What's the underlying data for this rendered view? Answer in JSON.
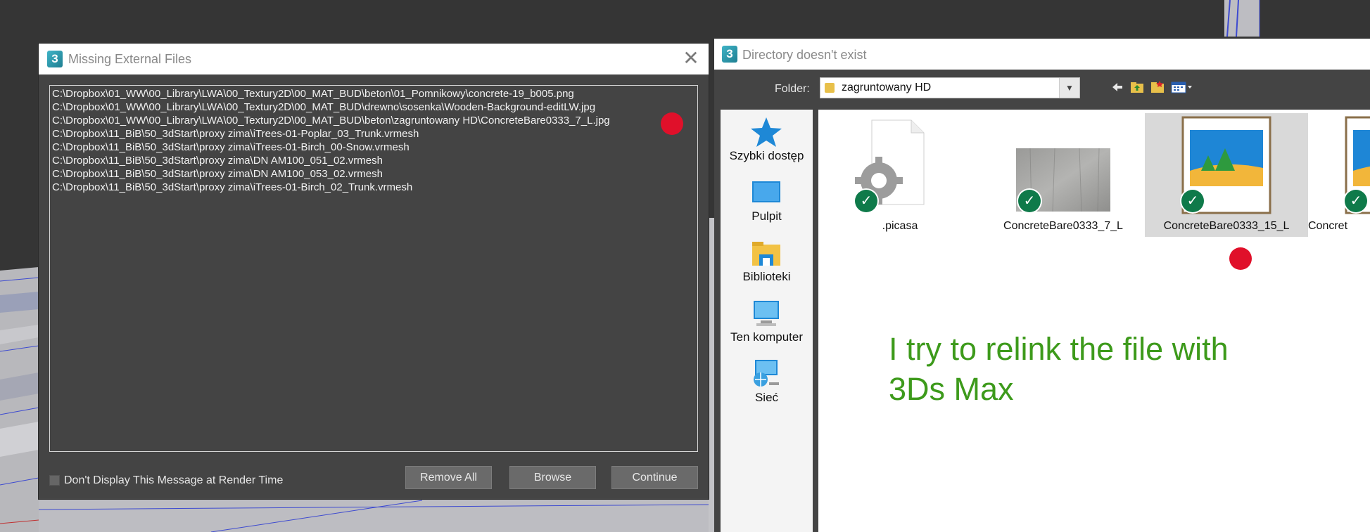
{
  "missing_dialog": {
    "title": "Missing External Files",
    "files": [
      "C:\\Dropbox\\01_WW\\00_Library\\LWA\\00_Textury2D\\00_MAT_BUD\\beton\\01_Pomnikowy\\concrete-19_b005.png",
      "C:\\Dropbox\\01_WW\\00_Library\\LWA\\00_Textury2D\\00_MAT_BUD\\drewno\\sosenka\\Wooden-Background-editLW.jpg",
      "C:\\Dropbox\\01_WW\\00_Library\\LWA\\00_Textury2D\\00_MAT_BUD\\beton\\zagruntowany HD\\ConcreteBare0333_7_L.jpg",
      "C:\\Dropbox\\11_BiB\\50_3dStart\\proxy zima\\iTrees-01-Poplar_03_Trunk.vrmesh",
      "C:\\Dropbox\\11_BiB\\50_3dStart\\proxy zima\\iTrees-01-Birch_00-Snow.vrmesh",
      "C:\\Dropbox\\11_BiB\\50_3dStart\\proxy zima\\DN AM100_051_02.vrmesh",
      "C:\\Dropbox\\11_BiB\\50_3dStart\\proxy zima\\DN AM100_053_02.vrmesh",
      "C:\\Dropbox\\11_BiB\\50_3dStart\\proxy zima\\iTrees-01-Birch_02_Trunk.vrmesh"
    ],
    "checkbox_label": "Don't Display This Message at Render Time",
    "buttons": {
      "remove_all": "Remove All",
      "browse": "Browse",
      "continue": "Continue"
    }
  },
  "directory_dialog": {
    "title": "Directory doesn't exist",
    "folder_label": "Folder:",
    "folder_value": "zagruntowany HD",
    "places": [
      "Szybki dostęp",
      "Pulpit",
      "Biblioteki",
      "Ten komputer",
      "Sieć"
    ],
    "files": [
      ".picasa",
      "ConcreteBare0333_7_L",
      "ConcreteBare0333_15_L",
      "Concret"
    ],
    "annotation": "I try to relink the file with 3Ds Max"
  },
  "app_icon_glyph": "3",
  "colors": {
    "annotation": "#3d9a1b",
    "red_marker": "#e0102a",
    "check": "#0f7a4a"
  }
}
